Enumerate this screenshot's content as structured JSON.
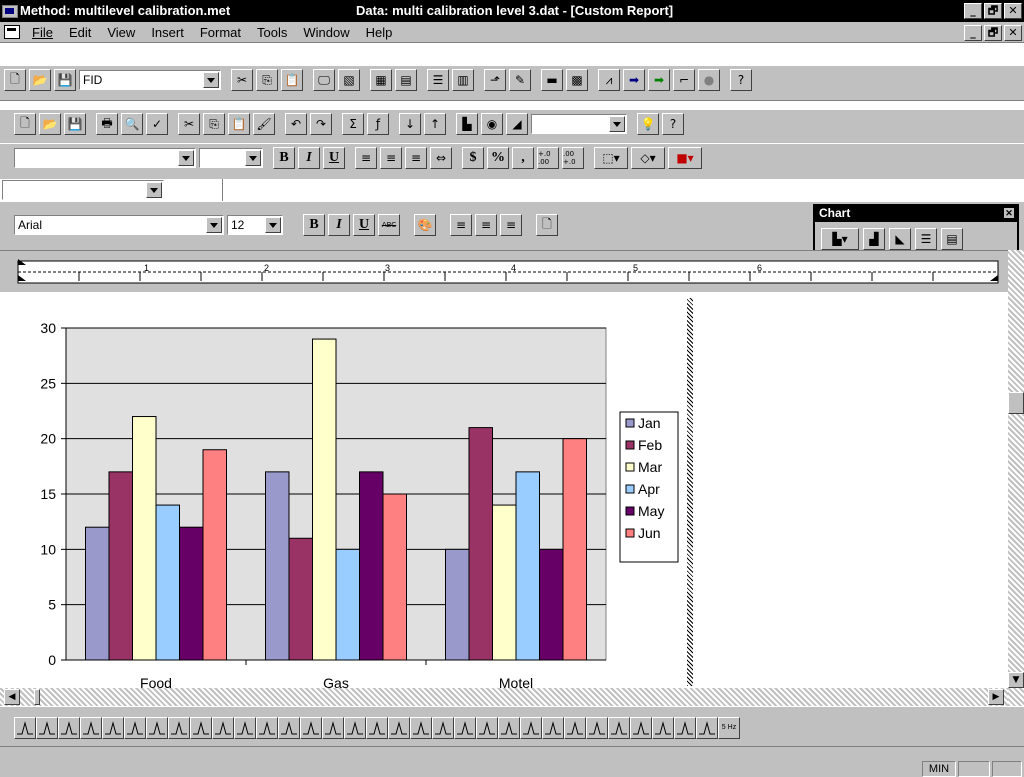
{
  "title": {
    "method": "Method: multilevel calibration.met",
    "data": "Data: multi calibration level 3.dat - [Custom Report]"
  },
  "window_buttons": [
    "_",
    "🗗",
    "✕"
  ],
  "menu": [
    "File",
    "Edit",
    "View",
    "Insert",
    "Format",
    "Tools",
    "Window",
    "Help"
  ],
  "toolbar1": {
    "detector": "FID"
  },
  "toolbar2": {
    "zoom": ""
  },
  "format_toolbar": {
    "font": "",
    "size": "",
    "bold": "B",
    "italic": "I",
    "underline": "U",
    "currency": "$",
    "percent": "%",
    "comma": ",",
    "inc_decimal": "+.0 .00",
    "dec_decimal": ".00 +.0"
  },
  "namebox": "",
  "text_toolbar": {
    "font": "Arial",
    "size": "12",
    "bold": "B",
    "italic": "I",
    "underline": "U",
    "strike": "ABC"
  },
  "chart_palette": {
    "title": "Chart",
    "close": "✕"
  },
  "ruler": {
    "labels": [
      "1",
      "2",
      "3",
      "4",
      "5",
      "6"
    ]
  },
  "bottom_toolbar": {
    "last_label": "5 Hz"
  },
  "status": {
    "mode": "MIN"
  },
  "colors": {
    "jan": "#9999cc",
    "feb": "#993366",
    "mar": "#ffffcc",
    "apr": "#99ccff",
    "may": "#660066",
    "jun": "#ff8080",
    "plot_bg": "#e0e0e0"
  },
  "chart_data": {
    "type": "bar",
    "categories": [
      "Food",
      "Gas",
      "Motel"
    ],
    "series": [
      {
        "name": "Jan",
        "values": [
          12,
          17,
          10
        ]
      },
      {
        "name": "Feb",
        "values": [
          17,
          11,
          21
        ]
      },
      {
        "name": "Mar",
        "values": [
          22,
          29,
          14
        ]
      },
      {
        "name": "Apr",
        "values": [
          14,
          10,
          17
        ]
      },
      {
        "name": "May",
        "values": [
          12,
          17,
          10
        ]
      },
      {
        "name": "Jun",
        "values": [
          19,
          15,
          20
        ]
      }
    ],
    "ylim": [
      0,
      30
    ],
    "yticks": [
      0,
      5,
      10,
      15,
      20,
      25,
      30
    ],
    "grid": true,
    "legend": "right"
  }
}
